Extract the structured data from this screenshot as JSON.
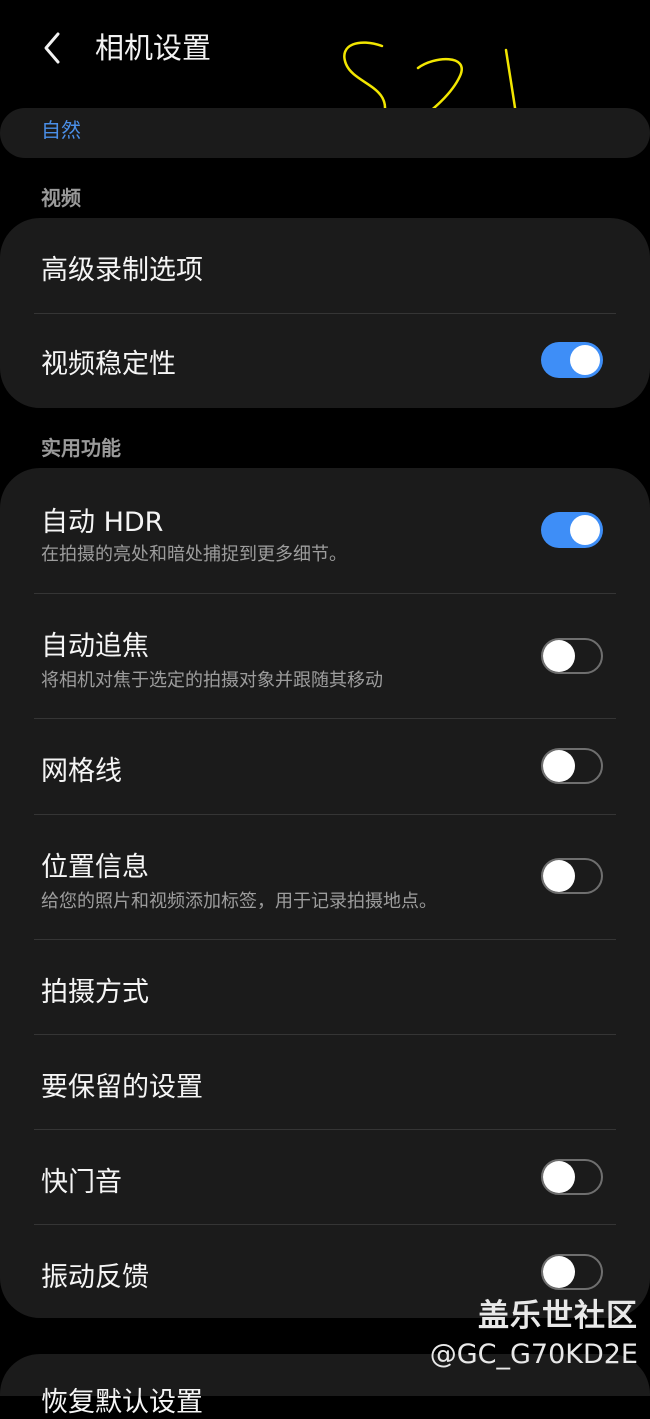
{
  "header": {
    "back_icon": "chevron-left-icon",
    "title": "相机设置"
  },
  "top_card": {
    "label": "自然"
  },
  "sections": {
    "video": "视频",
    "utility": "实用功能"
  },
  "video_items": [
    {
      "title": "高级录制选项"
    },
    {
      "title": "视频稳定性",
      "toggle": true
    }
  ],
  "utility_items": [
    {
      "title": "自动 HDR",
      "subtitle": "在拍摄的亮处和暗处捕捉到更多细节。",
      "toggle": true
    },
    {
      "title": "自动追焦",
      "subtitle": "将相机对焦于选定的拍摄对象并跟随其移动",
      "toggle": false
    },
    {
      "title": "网格线",
      "toggle": false
    },
    {
      "title": "位置信息",
      "subtitle": "给您的照片和视频添加标签，用于记录拍摄地点。",
      "toggle": false
    },
    {
      "title": "拍摄方式"
    },
    {
      "title": "要保留的设置"
    },
    {
      "title": "快门音",
      "toggle": false
    },
    {
      "title": "振动反馈",
      "toggle": false
    }
  ],
  "bottom_item": {
    "title": "恢复默认设置"
  },
  "watermark": {
    "line1": "盖乐世社区",
    "line2": "@GC_G70KD2E"
  },
  "colors": {
    "background": "#000000",
    "card": "#1b1b1b",
    "accent": "#3e8ef7",
    "link": "#4a8fe8",
    "handwriting": "#f2e600"
  }
}
